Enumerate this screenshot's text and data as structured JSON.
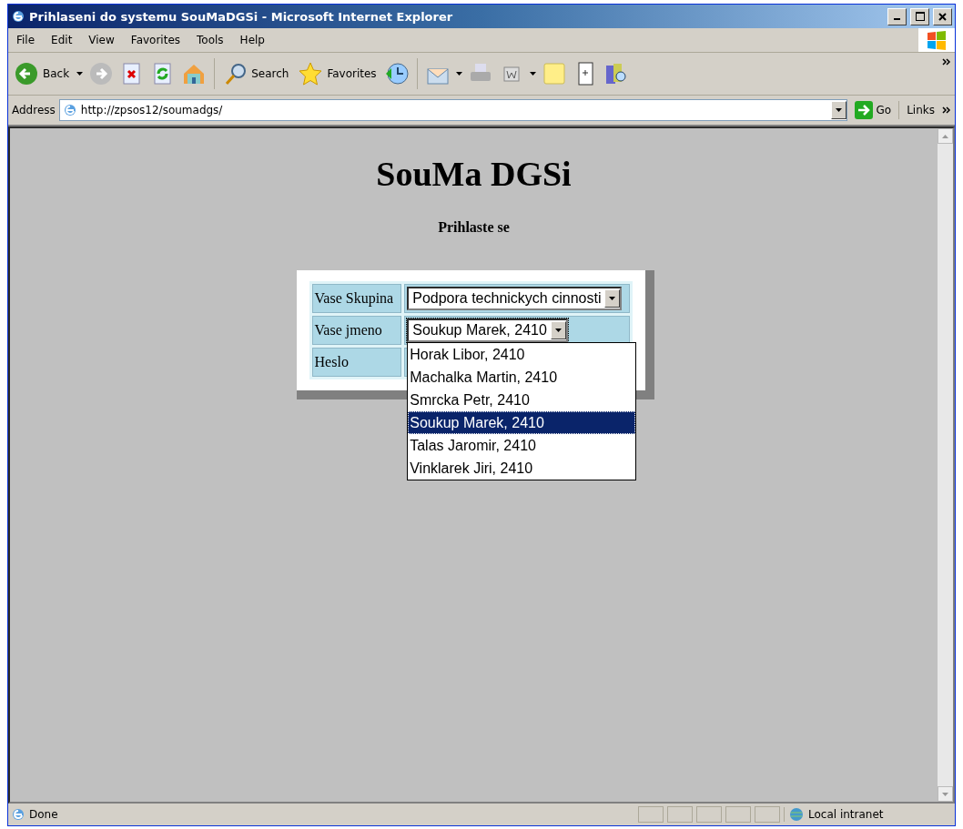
{
  "window": {
    "title": "Prihlaseni do systemu SouMaDGSi - Microsoft Internet Explorer"
  },
  "menu": [
    {
      "label": "File"
    },
    {
      "label": "Edit"
    },
    {
      "label": "View"
    },
    {
      "label": "Favorites"
    },
    {
      "label": "Tools"
    },
    {
      "label": "Help"
    }
  ],
  "toolbar": {
    "back": "Back",
    "search": "Search",
    "favorites": "Favorites"
  },
  "address_bar": {
    "label": "Address",
    "url": "http://zpsos12/soumadgs/",
    "go": "Go",
    "links": "Links"
  },
  "page": {
    "heading": "SouMa DGSi",
    "subheading": "Prihlaste se",
    "form": [
      {
        "kind": "select",
        "label": "Vase Skupina",
        "value": "Podpora technickych cinnosti"
      },
      {
        "kind": "select",
        "label": "Vase jmeno",
        "value": "Soukup Marek, 2410",
        "expanded": true
      },
      {
        "kind": "password",
        "label": "Heslo"
      }
    ],
    "dropdown": [
      {
        "label": "Horak Libor, 2410",
        "selected": false
      },
      {
        "label": "Machalka Martin, 2410",
        "selected": false
      },
      {
        "label": "Smrcka Petr, 2410",
        "selected": false
      },
      {
        "label": "Soukup Marek, 2410",
        "selected": true
      },
      {
        "label": "Talas Jaromir, 2410",
        "selected": false
      },
      {
        "label": "Vinklarek Jiri, 2410",
        "selected": false
      }
    ]
  },
  "status_bar": {
    "text": "Done",
    "zone": "Local intranet"
  }
}
